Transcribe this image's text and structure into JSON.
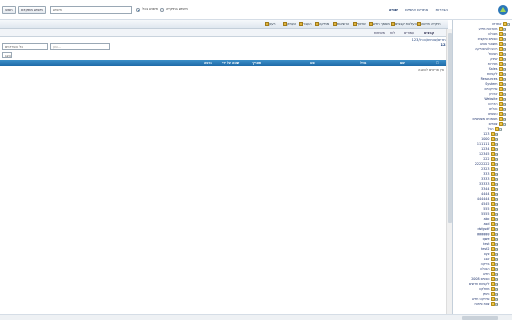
{
  "search": {
    "button_label": "חפש",
    "advanced_label": "חיפוש מתקדם",
    "input_value": "חיפוש",
    "option_all": "חיפוש בכל",
    "option_here": "חיפוש בתיקייה"
  },
  "brand_nav": [
    "שגיא",
    "אתרים אישיים",
    "הגדרות"
  ],
  "toolbar": [
    {
      "label": "תיקייה חדשה",
      "icon": "folder-new-icon"
    },
    {
      "label": "העלאת קבצים",
      "icon": "upload-icon"
    },
    {
      "label": "מסמך חדש",
      "icon": "new-doc-icon"
    },
    {
      "label": "שיתוף",
      "icon": "share-icon"
    },
    {
      "label": "הרשאות",
      "icon": "permissions-icon"
    },
    {
      "label": "מחיקה",
      "icon": "delete-icon"
    },
    {
      "label": "העבר",
      "icon": "move-icon"
    },
    {
      "label": "העתק",
      "icon": "copy-icon"
    },
    {
      "label": "רענן",
      "icon": "refresh-icon"
    }
  ],
  "tabs": [
    "קבצים",
    "עמודים",
    "לוח",
    "משימות"
  ],
  "breadcrumb": "אתרים/צוותים/הכל/123",
  "path_label": "123",
  "filter": {
    "placeholder": "סנן...",
    "select_value": "כל הפריטים",
    "view_label": "הצג"
  },
  "list_header": {
    "cols": [
      "שם",
      "גודל",
      "סוג",
      "תאריך",
      "שונה על ידי",
      "גרסה"
    ]
  },
  "empty_message": "אין פריטים להצגה",
  "tree": [
    {
      "label": "אתרים",
      "level": 0,
      "expanded": true
    },
    {
      "label": "מערכות מידע",
      "level": 1,
      "expanded": false
    },
    {
      "label": "מנהלה",
      "level": 1,
      "expanded": false
    },
    {
      "label": "כספים ותקציב",
      "level": 1,
      "expanded": false
    },
    {
      "label": "משאבי אנוש",
      "level": 1,
      "expanded": false
    },
    {
      "label": "רכש ולוגיסטיקה",
      "level": 1,
      "expanded": false
    },
    {
      "label": "תפעול",
      "level": 1,
      "expanded": false
    },
    {
      "label": "שיווק",
      "level": 1,
      "expanded": false
    },
    {
      "label": "מכירות",
      "level": 1,
      "expanded": false
    },
    {
      "label": "Sales",
      "level": 1,
      "expanded": false
    },
    {
      "label": "לקוחות",
      "level": 1,
      "expanded": false
    },
    {
      "label": "Resources",
      "level": 1,
      "expanded": false
    },
    {
      "label": "System",
      "level": 1,
      "expanded": false
    },
    {
      "label": "פרויקטים",
      "level": 1,
      "expanded": false
    },
    {
      "label": "ארכיון",
      "level": 1,
      "expanded": false
    },
    {
      "label": "Website",
      "level": 1,
      "expanded": false
    },
    {
      "label": "הדרכה",
      "level": 1,
      "expanded": false
    },
    {
      "label": "נהלים",
      "level": 1,
      "expanded": false
    },
    {
      "label": "טפסים",
      "level": 1,
      "expanded": false
    },
    {
      "label": "מסמכים משותפים",
      "level": 1,
      "expanded": false
    },
    {
      "label": "צוותים",
      "level": 1,
      "expanded": true
    },
    {
      "label": "הכל",
      "level": 2,
      "expanded": true
    },
    {
      "label": "123",
      "level": 3,
      "expanded": false
    },
    {
      "label": "1000",
      "level": 3,
      "expanded": false
    },
    {
      "label": "111111",
      "level": 3,
      "expanded": false
    },
    {
      "label": "1234",
      "level": 3,
      "expanded": false
    },
    {
      "label": "12345",
      "level": 3,
      "expanded": false
    },
    {
      "label": "222",
      "level": 3,
      "expanded": false
    },
    {
      "label": "2222222",
      "level": 3,
      "expanded": false
    },
    {
      "label": "2323",
      "level": 3,
      "expanded": false
    },
    {
      "label": "333",
      "level": 3,
      "expanded": false
    },
    {
      "label": "3333",
      "level": 3,
      "expanded": false
    },
    {
      "label": "33333",
      "level": 3,
      "expanded": false
    },
    {
      "label": "3344",
      "level": 3,
      "expanded": false
    },
    {
      "label": "4444",
      "level": 3,
      "expanded": false
    },
    {
      "label": "444444",
      "level": 3,
      "expanded": false
    },
    {
      "label": "4545",
      "level": 3,
      "expanded": false
    },
    {
      "label": "555",
      "level": 3,
      "expanded": false
    },
    {
      "label": "5555",
      "level": 3,
      "expanded": false
    },
    {
      "label": "abc",
      "level": 3,
      "expanded": false
    },
    {
      "label": "asd",
      "level": 3,
      "expanded": false
    },
    {
      "label": "dsfgsdf",
      "level": 3,
      "expanded": false
    },
    {
      "label": "gggggg",
      "level": 3,
      "expanded": false
    },
    {
      "label": "qwe",
      "level": 3,
      "expanded": false
    },
    {
      "label": "test",
      "level": 3,
      "expanded": false
    },
    {
      "label": "test2",
      "level": 3,
      "expanded": false
    },
    {
      "label": "xyz",
      "level": 3,
      "expanded": false
    },
    {
      "label": "אבג",
      "level": 3,
      "expanded": false
    },
    {
      "label": "בדיקה",
      "level": 3,
      "expanded": false
    },
    {
      "label": "הנהלה",
      "level": 3,
      "expanded": false
    },
    {
      "label": "חדש",
      "level": 3,
      "expanded": false
    },
    {
      "label": "כספים 2008",
      "level": 3,
      "expanded": false
    },
    {
      "label": "לקוחות חדשים",
      "level": 3,
      "expanded": false
    },
    {
      "label": "מחלקה",
      "level": 3,
      "expanded": false
    },
    {
      "label": "ניסיון",
      "level": 3,
      "expanded": false
    },
    {
      "label": "פרויקט חדש",
      "level": 3,
      "expanded": false
    },
    {
      "label": "צוות פיתוח",
      "level": 3,
      "expanded": false
    }
  ],
  "colors": {
    "accent": "#1f6aa8",
    "header_top": "#3d90c9",
    "folder": "#f0c64a",
    "link": "#1a2f6a"
  }
}
